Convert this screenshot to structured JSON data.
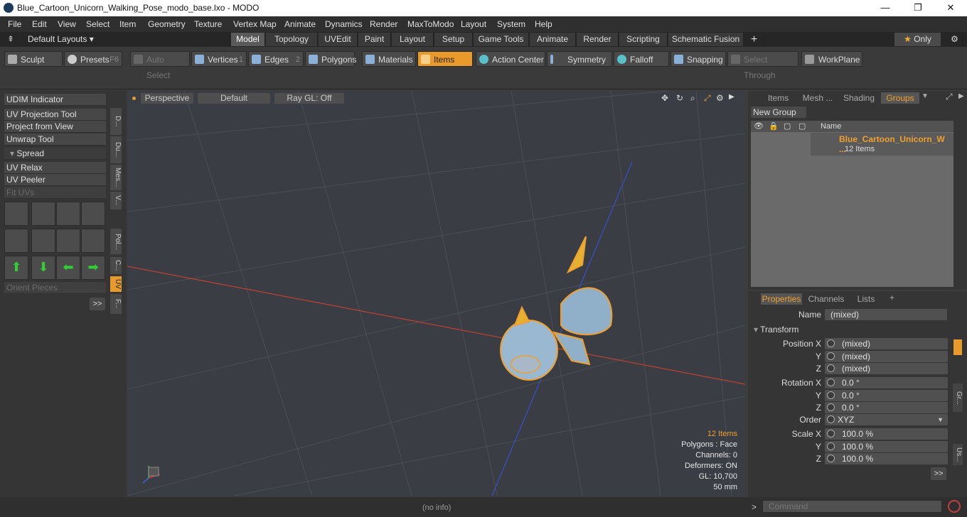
{
  "window": {
    "title": "Blue_Cartoon_Unicorn_Walking_Pose_modo_base.lxo - MODO",
    "minimize": "—",
    "maximize": "❐",
    "close": "✕"
  },
  "menu": [
    "File",
    "Edit",
    "View",
    "Select",
    "Item",
    "Geometry",
    "Texture",
    "Vertex Map",
    "Animate",
    "Dynamics",
    "Render",
    "MaxToModo",
    "Layout",
    "System",
    "Help"
  ],
  "layouts": {
    "label": "Default Layouts ▾",
    "tabs": [
      "Model",
      "Topology",
      "UVEdit",
      "Paint",
      "Layout",
      "Setup",
      "Game Tools",
      "Animate",
      "Render",
      "Scripting",
      "Schematic Fusion"
    ],
    "add": "+",
    "only": "Only"
  },
  "toolbar": {
    "sculpt": "Sculpt",
    "presets": "Presets",
    "presets_key": "F6",
    "auto_select": "Auto Select",
    "vertices": "Vertices",
    "vertices_key": "1",
    "edges": "Edges",
    "edges_key": "2",
    "polygons": "Polygons",
    "materials": "Materials",
    "items": "Items",
    "action_center": "Action Center",
    "symmetry": "Symmetry",
    "falloff": "Falloff",
    "snapping": "Snapping",
    "select_through": "Select Through",
    "workplane": "WorkPlane"
  },
  "left": {
    "items": [
      "UDIM Indicator",
      "UV Projection Tool",
      "Project from View",
      "Unwrap Tool",
      "Spread",
      "UV Relax",
      "UV Peeler",
      "Fit UVs"
    ],
    "orient": "Orient Pieces",
    "more": ">>",
    "vtabs": [
      "D...",
      "Du...",
      "Mes...",
      "V...",
      "Pol...",
      "C...",
      "UV",
      "F..."
    ]
  },
  "viewport": {
    "perspective": "Perspective",
    "default": "Default",
    "raygl": "Ray GL: Off",
    "stats": [
      "12 Items",
      "Polygons : Face",
      "Channels: 0",
      "Deformers: ON",
      "GL: 10,700",
      "50 mm"
    ]
  },
  "groups": {
    "tabs": [
      "Items",
      "Mesh ...",
      "Shading",
      "Groups"
    ],
    "new_group": "New Group",
    "col_name": "Name",
    "item_name": "Blue_Cartoon_Unicorn_W ...",
    "item_count": "12 Items"
  },
  "props": {
    "tabs": [
      "Properties",
      "Channels",
      "Lists"
    ],
    "add": "+",
    "name_label": "Name",
    "name_value": "(mixed)",
    "transform": "Transform",
    "rows": [
      {
        "l": "Position X",
        "v": "(mixed)"
      },
      {
        "l": "Y",
        "v": "(mixed)"
      },
      {
        "l": "Z",
        "v": "(mixed)"
      },
      {
        "l": "Rotation X",
        "v": "0.0 °"
      },
      {
        "l": "Y",
        "v": "0.0 °"
      },
      {
        "l": "Z",
        "v": "0.0 °"
      },
      {
        "l": "Order",
        "v": "XYZ"
      },
      {
        "l": "Scale X",
        "v": "100.0 %"
      },
      {
        "l": "Y",
        "v": "100.0 %"
      },
      {
        "l": "Z",
        "v": "100.0 %"
      }
    ],
    "more": ">>",
    "side": [
      "Gr...",
      "Us..."
    ]
  },
  "status": {
    "info": "(no info)",
    "command_placeholder": "Command",
    "prompt": ">"
  },
  "colors": {
    "accent": "#f0a030",
    "active_tab": "#e89a2a",
    "x_axis": "#d04030",
    "z_axis": "#3050d0"
  }
}
